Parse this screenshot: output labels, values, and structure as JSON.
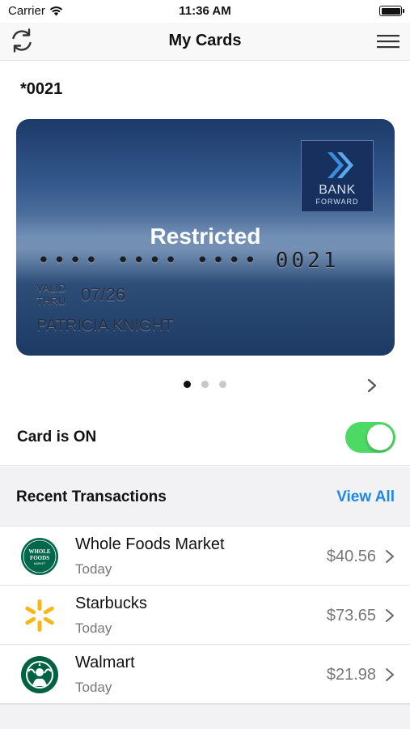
{
  "status_bar": {
    "carrier": "Carrier",
    "time": "11:36 AM"
  },
  "nav": {
    "title": "My Cards",
    "left_icon": "refresh-icon",
    "right_icon": "menu-icon"
  },
  "card": {
    "number_label": "*0021",
    "bank_name": "BANK",
    "bank_subtitle": "FORWARD",
    "status": "Restricted",
    "masked_number": "•••• •••• •••• 0021",
    "valid_thru_line1": "VALID",
    "valid_thru_line2": "THRU",
    "expiry": "07/26",
    "holder": "PATRICIA KNIGHT"
  },
  "pager": {
    "count": 3,
    "active_index": 0
  },
  "toggle": {
    "label": "Card is ON",
    "on": true,
    "color": "#4cd964"
  },
  "transactions": {
    "title": "Recent Transactions",
    "view_all": "View All",
    "accent": "#1e88e5",
    "items": [
      {
        "merchant": "Whole Foods Market",
        "date": "Today",
        "amount": "$40.56",
        "logo_text_1": "WHOLE",
        "logo_text_2": "FOODS",
        "logo_text_3": "MARKET"
      },
      {
        "merchant": "Starbucks",
        "date": "Today",
        "amount": "$73.65"
      },
      {
        "merchant": "Walmart",
        "date": "Today",
        "amount": "$21.98"
      }
    ]
  }
}
